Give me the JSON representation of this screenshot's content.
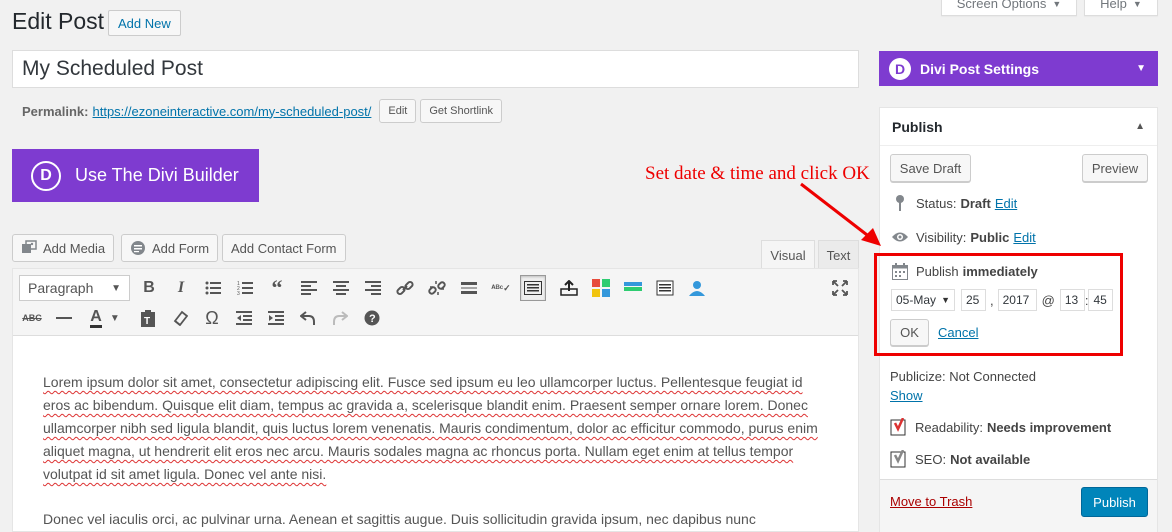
{
  "header": {
    "title": "Edit Post",
    "add_new": "Add New",
    "screen_options": "Screen Options",
    "help": "Help"
  },
  "post": {
    "title": "My Scheduled Post",
    "permalink_label": "Permalink:",
    "permalink_url": "https://ezoneinteractive.com/my-scheduled-post/",
    "edit_label": "Edit",
    "shortlink_label": "Get Shortlink"
  },
  "divi_builder": {
    "logo_letter": "D",
    "label": "Use The Divi Builder"
  },
  "media": {
    "add_media": "Add Media",
    "add_form": "Add Form",
    "add_contact_form": "Add Contact Form"
  },
  "editor_tabs": {
    "visual": "Visual",
    "text": "Text"
  },
  "toolbar": {
    "format_value": "Paragraph"
  },
  "content": {
    "paragraph1": "Lorem ipsum dolor sit amet, consectetur adipiscing elit. Fusce sed ipsum eu leo ullamcorper luctus. Pellentesque feugiat id eros ac bibendum. Quisque elit diam, tempus ac gravida a, scelerisque blandit enim. Praesent semper ornare lorem. Donec ullamcorper nibh sed ligula blandit, quis luctus lorem venenatis. Mauris condimentum, dolor ac efficitur commodo, purus enim aliquet magna, ut hendrerit elit eros nec arcu. Mauris sodales magna ac rhoncus porta. Nullam eget enim at tellus tempor volutpat id sit amet ligula. Donec vel ante nisi.",
    "paragraph2": "Donec vel iaculis orci, ac pulvinar urna. Aenean et sagittis augue. Duis sollicitudin gravida ipsum, nec dapibus nunc"
  },
  "sidebar": {
    "divi_settings_logo": "D",
    "divi_settings": "Divi Post Settings",
    "publish_title": "Publish",
    "save_draft": "Save Draft",
    "preview": "Preview",
    "status_label": "Status:",
    "status_value": "Draft",
    "visibility_label": "Visibility:",
    "visibility_value": "Public",
    "edit": "Edit",
    "publish_label": "Publish",
    "publish_value": "immediately",
    "month": "05-May",
    "day": "25",
    "year": "2017",
    "hour": "13",
    "minute": "45",
    "comma": ",",
    "at": "@",
    "colon": ":",
    "ok": "OK",
    "cancel": "Cancel",
    "publicize": "Publicize: Not Connected",
    "show": "Show",
    "readability_label": "Readability:",
    "readability_value": "Needs improvement",
    "seo_label": "SEO:",
    "seo_value": "Not available",
    "trash": "Move to Trash",
    "publish_button": "Publish"
  },
  "annotation": {
    "text": "Set date & time and click OK"
  },
  "colors": {
    "divi_purple": "#7e3bd0",
    "wp_blue": "#0073aa",
    "publish_blue": "#0085ba",
    "annotation_red": "#e00000"
  }
}
